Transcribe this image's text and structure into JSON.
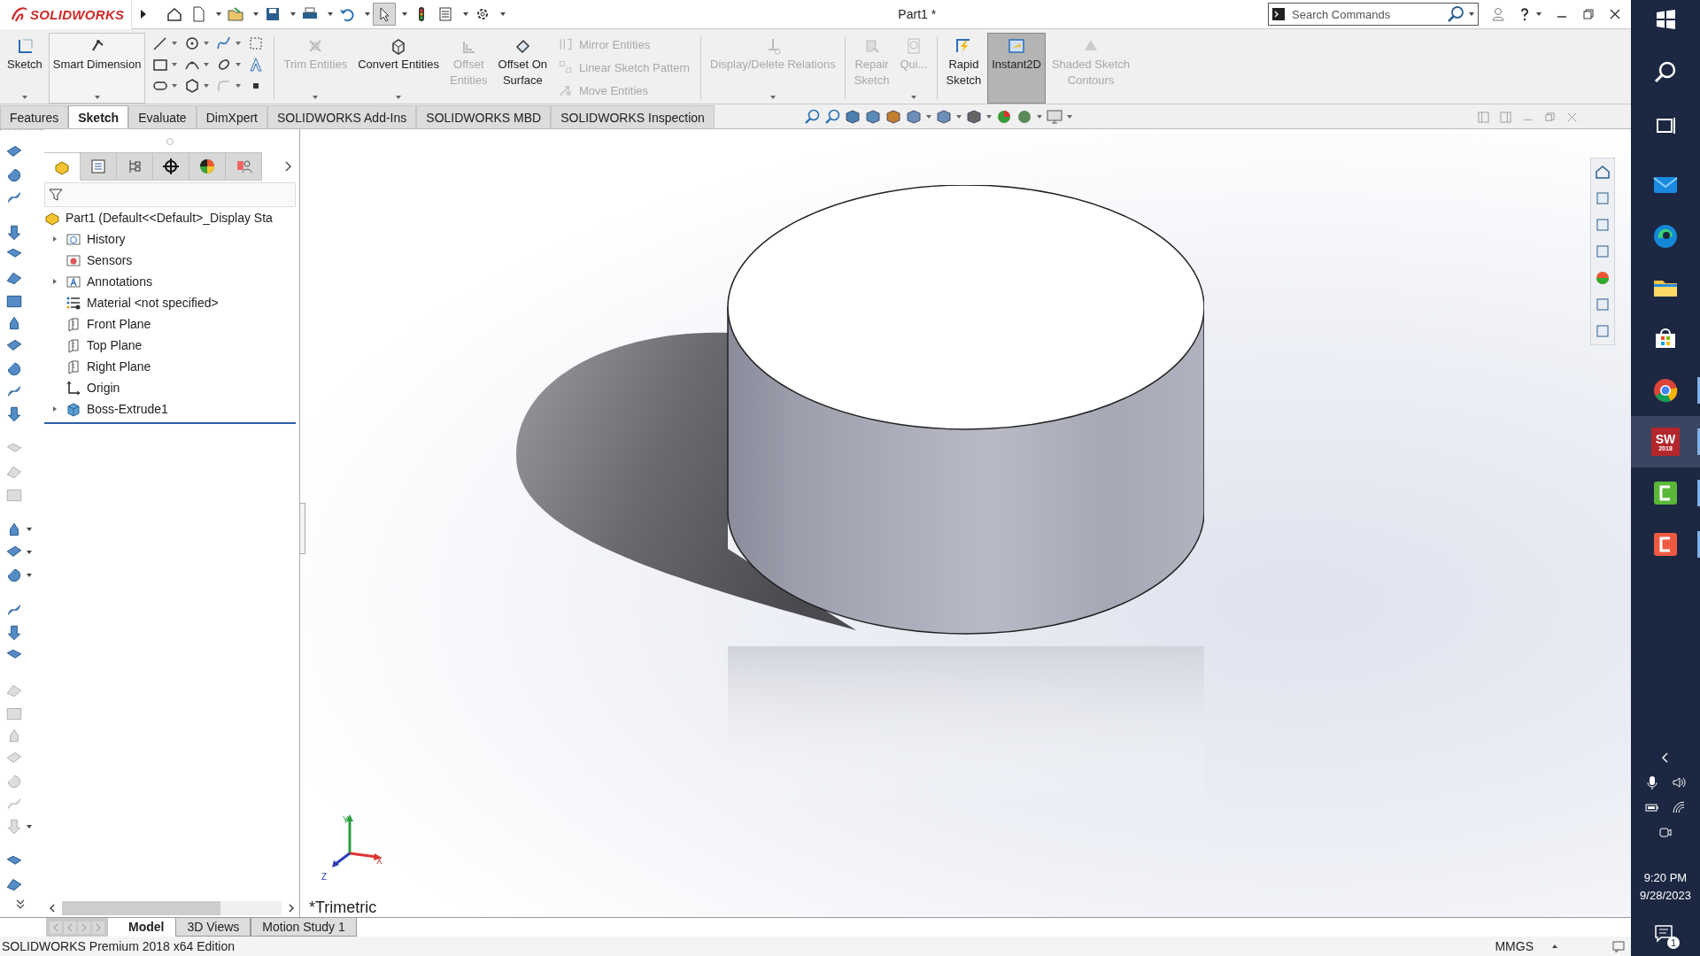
{
  "app": {
    "logo": "SOLIDWORKS",
    "title": "Part1 *",
    "search": {
      "placeholder": "Search Commands"
    }
  },
  "ribbon": [
    {
      "kind": "large",
      "label": [
        "Sketch"
      ],
      "disabled": false,
      "selected": false,
      "dropdown": true
    },
    {
      "kind": "large",
      "label": [
        "Smart Dimension"
      ],
      "disabled": false,
      "selected": false,
      "dropdown": true
    },
    {
      "kind": "grid"
    },
    {
      "kind": "large",
      "label": [
        "Trim Entities"
      ],
      "disabled": true,
      "selected": false,
      "dropdown": true
    },
    {
      "kind": "large",
      "label": [
        "Convert Entities"
      ],
      "disabled": false,
      "selected": false,
      "dropdown": true
    },
    {
      "kind": "large",
      "label": [
        "Offset",
        "Entities"
      ],
      "disabled": true,
      "selected": false,
      "dropdown": false
    },
    {
      "kind": "large",
      "label": [
        "Offset On",
        "Surface"
      ],
      "disabled": false,
      "selected": false,
      "dropdown": false
    },
    {
      "kind": "stack",
      "items": [
        {
          "label": "Mirror Entities",
          "disabled": true
        },
        {
          "label": "Linear Sketch Pattern",
          "disabled": true
        },
        {
          "label": "Move Entities",
          "disabled": true
        }
      ]
    },
    {
      "kind": "large",
      "label": [
        "Display/Delete Relations"
      ],
      "disabled": true,
      "selected": false,
      "dropdown": true
    },
    {
      "kind": "large",
      "label": [
        "Repair",
        "Sketch"
      ],
      "disabled": true,
      "selected": false,
      "dropdown": false
    },
    {
      "kind": "large",
      "label": [
        "Qui..."
      ],
      "disabled": true,
      "selected": false,
      "dropdown": true
    },
    {
      "kind": "large",
      "label": [
        "Rapid",
        "Sketch"
      ],
      "disabled": false,
      "selected": false,
      "dropdown": false
    },
    {
      "kind": "large",
      "label": [
        "Instant2D"
      ],
      "disabled": false,
      "selected": true,
      "dropdown": false
    },
    {
      "kind": "large",
      "label": [
        "Shaded Sketch",
        "Contours"
      ],
      "disabled": true,
      "selected": false,
      "dropdown": false
    }
  ],
  "tabs": [
    {
      "label": "Features",
      "selected": false
    },
    {
      "label": "Sketch",
      "selected": true
    },
    {
      "label": "Evaluate",
      "selected": false
    },
    {
      "label": "DimXpert",
      "selected": false
    },
    {
      "label": "SOLIDWORKS Add-Ins",
      "selected": false
    },
    {
      "label": "SOLIDWORKS MBD",
      "selected": false
    },
    {
      "label": "SOLIDWORKS Inspection",
      "selected": false
    }
  ],
  "panel_tabs": [
    {
      "selected": true
    },
    {
      "selected": false
    },
    {
      "selected": false
    },
    {
      "selected": false
    },
    {
      "selected": false
    },
    {
      "selected": false
    }
  ],
  "tree": {
    "root": "Part1  (Default<<Default>_Display Sta",
    "children": [
      {
        "label": "History",
        "expandable": true
      },
      {
        "label": "Sensors",
        "expandable": false
      },
      {
        "label": "Annotations",
        "expandable": true
      },
      {
        "label": "Material <not specified>",
        "expandable": false
      },
      {
        "label": "Front Plane",
        "expandable": false
      },
      {
        "label": "Top Plane",
        "expandable": false
      },
      {
        "label": "Right Plane",
        "expandable": false
      },
      {
        "label": "Origin",
        "expandable": false
      },
      {
        "label": "Boss-Extrude1",
        "expandable": true
      }
    ]
  },
  "view": {
    "name": "*Trimetric",
    "axes": [
      "X",
      "Y",
      "Z"
    ]
  },
  "bottom_tabs": [
    {
      "label": "Model",
      "selected": true
    },
    {
      "label": "3D Views",
      "selected": false
    },
    {
      "label": "Motion Study 1",
      "selected": false
    }
  ],
  "status_bar": {
    "edition": "SOLIDWORKS Premium 2018 x64 Edition",
    "units": "MMGS"
  },
  "taskbar": {
    "apps": [
      {
        "kind": "mail",
        "running": false,
        "selected": false
      },
      {
        "kind": "edge",
        "running": false,
        "selected": false
      },
      {
        "kind": "folder",
        "running": false,
        "selected": false
      },
      {
        "kind": "store",
        "running": false,
        "selected": false
      },
      {
        "kind": "chrome",
        "running": true,
        "selected": false
      },
      {
        "kind": "solidworks",
        "running": true,
        "selected": true
      },
      {
        "kind": "camtasia-green",
        "running": true,
        "selected": false
      },
      {
        "kind": "camtasia-red",
        "running": true,
        "selected": false
      }
    ],
    "sw_badge": [
      "SW",
      "2018"
    ],
    "time": "9:20 PM",
    "date": "9/28/2023",
    "notifications": "1"
  }
}
